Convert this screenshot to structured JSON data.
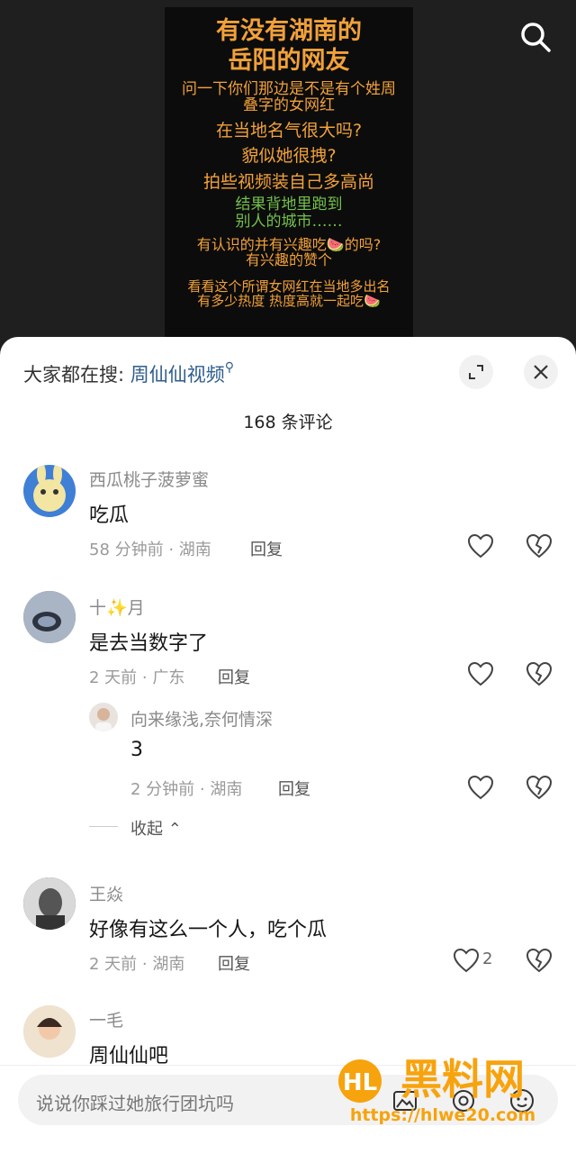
{
  "video": {
    "lines": [
      "有没有湖南的",
      "岳阳的网友",
      "问一下你们那边是不是有个姓周",
      "叠字的女网红",
      "在当地名气很大吗?",
      "貌似她很拽?",
      "拍些视频装自己多高尚",
      "结果背地里跑到",
      "别人的城市……",
      "有认识的并有兴趣吃🍉的吗?",
      "有兴趣的赞个",
      "看看这个所谓女网红在当地多出名",
      "有多少热度 热度高就一起吃🍉"
    ]
  },
  "sheet": {
    "hot_label": "大家都在搜:",
    "hot_keyword": "周仙仙视频",
    "comment_count": "168 条评论",
    "collapse_label": "收起",
    "reply_label": "回复"
  },
  "comments": [
    {
      "name": "西瓜桃子菠萝蜜",
      "text": "吃瓜",
      "meta": "58 分钟前 · 湖南"
    },
    {
      "name": "十✨月",
      "text": "是去当数字了",
      "meta": "2 天前 · 广东"
    },
    {
      "name": "向来缘浅,奈何情深",
      "text": "3",
      "meta": "2 分钟前 · 湖南"
    },
    {
      "name": "王焱",
      "text": "好像有这么一个人，吃个瓜",
      "meta": "2 天前 · 湖南",
      "likes": "2"
    },
    {
      "name": "一毛",
      "text": "周仙仙吧"
    }
  ],
  "input": {
    "placeholder": "说说你踩过她旅行团坑吗"
  },
  "watermark": {
    "brand": "黑料网",
    "url": "https://hlwe20.com"
  },
  "colors": {
    "accent": "#2f5d8c",
    "poster_orange": "#f2a13a",
    "poster_green": "#73c04b"
  }
}
